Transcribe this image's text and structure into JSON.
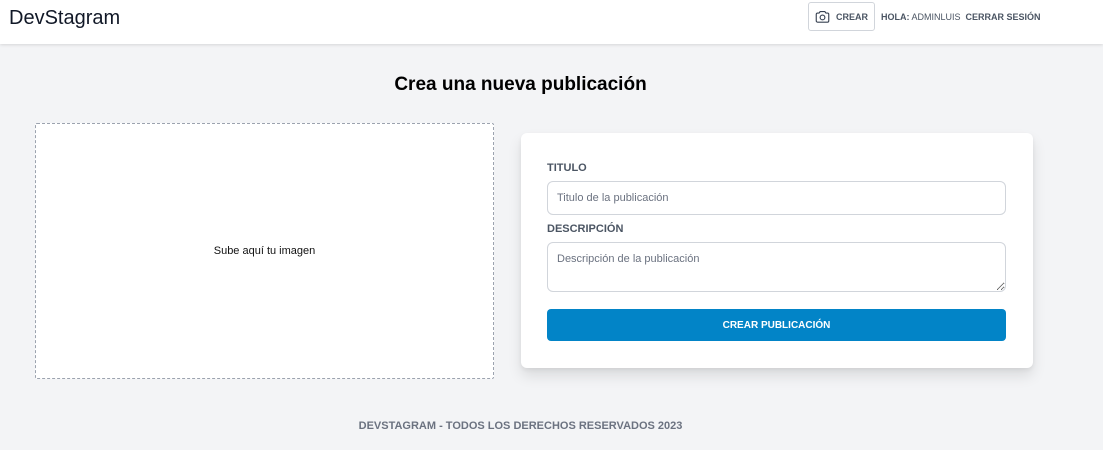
{
  "header": {
    "brand": "DevStagram",
    "create_label": "CREAR",
    "create_icon": "camera-icon",
    "greeting_prefix": "HOLA:",
    "username": "ADMINLUIS",
    "logout_label": "CERRAR SESIÓN"
  },
  "main": {
    "title": "Crea una nueva publicación",
    "dropzone_text": "Sube aquí tu imagen",
    "form": {
      "title_label": "TITULO",
      "title_placeholder": "Titulo de la publicación",
      "title_value": "",
      "description_label": "DESCRIPCIÓN",
      "description_placeholder": "Descripción de la publicación",
      "description_value": "",
      "submit_label": "CREAR PUBLICACIÓN"
    }
  },
  "footer": {
    "text": "DEVSTAGRAM - TODOS LOS DERECHOS RESERVADOS 2023"
  },
  "colors": {
    "background": "#f3f4f6",
    "primary_button": "#0284c7",
    "muted_text": "#4b5563"
  }
}
